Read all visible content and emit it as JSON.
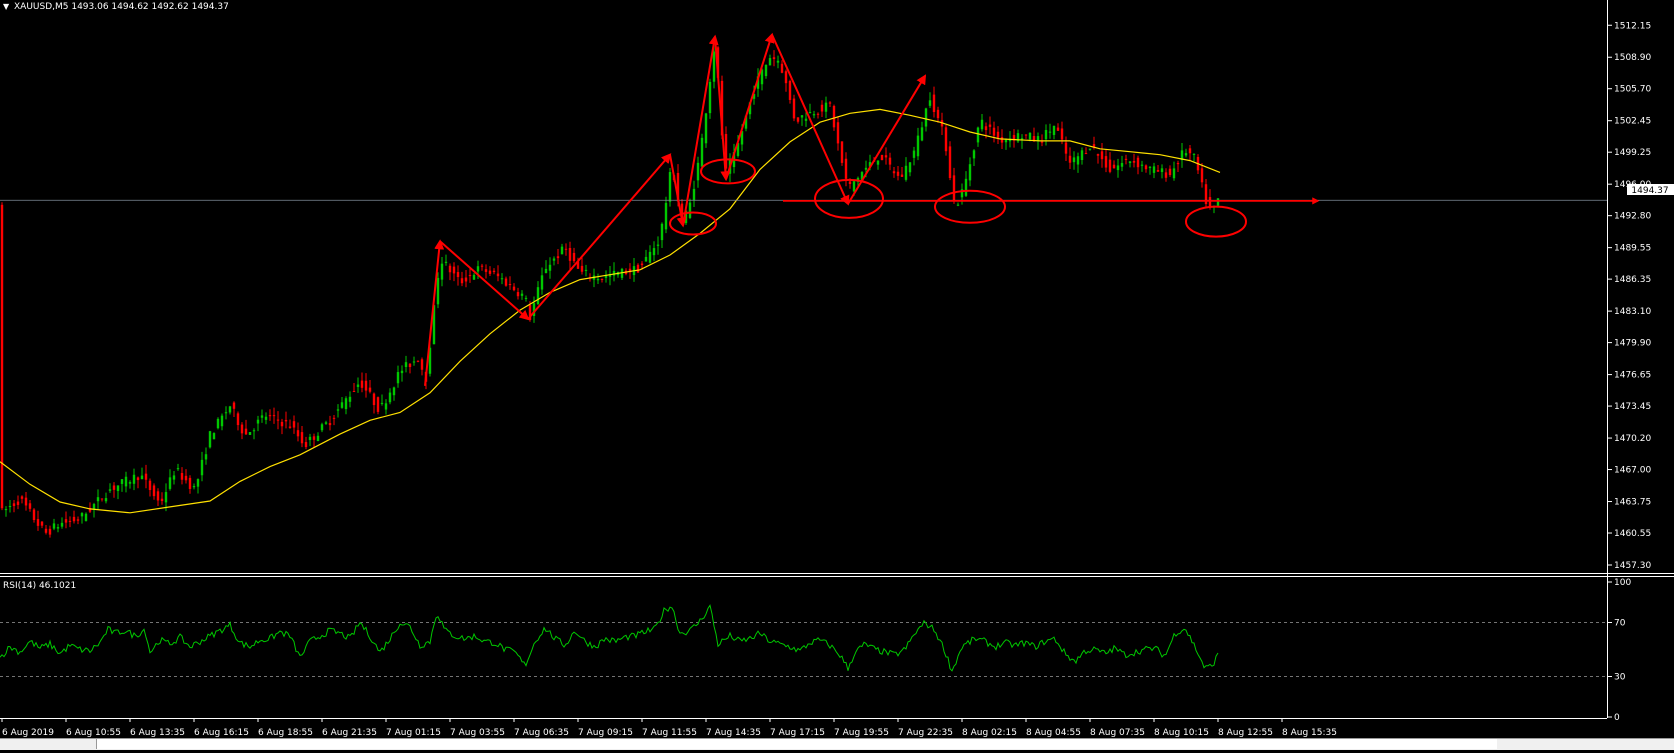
{
  "chart_data": [
    {
      "type": "candlestick",
      "title": "XAUUSD,M5  1493.06 1494.62 1492.62 1494.37",
      "symbol": "XAUUSD,M5",
      "ohlc": {
        "open": 1493.06,
        "high": 1494.62,
        "low": 1492.62,
        "close": 1494.37
      },
      "ylim": [
        1457.3,
        1513.7
      ],
      "y_ticks": [
        "1512.15",
        "1508.90",
        "1505.70",
        "1502.45",
        "1499.25",
        "1496.00",
        "1492.80",
        "1489.55",
        "1486.35",
        "1483.10",
        "1479.90",
        "1476.65",
        "1473.45",
        "1470.20",
        "1467.00",
        "1463.75",
        "1460.55",
        "1457.30"
      ],
      "current_price_label": "1494.37",
      "bull_color": "#00c800",
      "bear_color": "#ff0000",
      "ma_color": "#ffe000",
      "annotation_color": "#ff0000",
      "price_path": [
        [
          0,
          1462.5
        ],
        [
          20,
          1464.0
        ],
        [
          45,
          1460.5
        ],
        [
          60,
          1461.5
        ],
        [
          80,
          1462.0
        ],
        [
          110,
          1465.0
        ],
        [
          140,
          1466.5
        ],
        [
          160,
          1463.5
        ],
        [
          175,
          1467.0
        ],
        [
          195,
          1465.0
        ],
        [
          210,
          1470.5
        ],
        [
          230,
          1473.5
        ],
        [
          245,
          1470.5
        ],
        [
          265,
          1472.5
        ],
        [
          290,
          1471.5
        ],
        [
          305,
          1469.5
        ],
        [
          330,
          1472.0
        ],
        [
          360,
          1476.0
        ],
        [
          380,
          1473.0
        ],
        [
          400,
          1477.0
        ],
        [
          420,
          1478.5
        ],
        [
          425,
          1475.5
        ],
        [
          440,
          1488.5
        ],
        [
          460,
          1486.0
        ],
        [
          480,
          1487.5
        ],
        [
          500,
          1486.5
        ],
        [
          525,
          1484.5
        ],
        [
          530,
          1482.5
        ],
        [
          545,
          1487.5
        ],
        [
          565,
          1489.5
        ],
        [
          580,
          1487.0
        ],
        [
          600,
          1486.5
        ],
        [
          620,
          1487.0
        ],
        [
          640,
          1487.5
        ],
        [
          660,
          1490.5
        ],
        [
          672,
          1498.0
        ],
        [
          682,
          1492.0
        ],
        [
          690,
          1494.0
        ],
        [
          700,
          1499.0
        ],
        [
          715,
          1510.5
        ],
        [
          725,
          1497.0
        ],
        [
          735,
          1499.0
        ],
        [
          755,
          1506.0
        ],
        [
          770,
          1509.0
        ],
        [
          780,
          1508.5
        ],
        [
          795,
          1502.5
        ],
        [
          815,
          1503.5
        ],
        [
          830,
          1504.0
        ],
        [
          840,
          1499.0
        ],
        [
          848,
          1495.5
        ],
        [
          860,
          1497.0
        ],
        [
          880,
          1499.0
        ],
        [
          900,
          1496.5
        ],
        [
          915,
          1499.5
        ],
        [
          930,
          1505.0
        ],
        [
          945,
          1500.5
        ],
        [
          955,
          1493.5
        ],
        [
          965,
          1496.0
        ],
        [
          980,
          1502.5
        ],
        [
          1000,
          1500.5
        ],
        [
          1020,
          1501.0
        ],
        [
          1040,
          1500.5
        ],
        [
          1055,
          1502.0
        ],
        [
          1070,
          1498.0
        ],
        [
          1090,
          1500.0
        ],
        [
          1110,
          1497.5
        ],
        [
          1130,
          1498.5
        ],
        [
          1150,
          1497.5
        ],
        [
          1170,
          1497.0
        ],
        [
          1185,
          1499.5
        ],
        [
          1195,
          1498.5
        ],
        [
          1205,
          1494.5
        ],
        [
          1212,
          1493.0
        ],
        [
          1218,
          1494.4
        ]
      ],
      "moving_average": [
        [
          0,
          1467.8
        ],
        [
          30,
          1465.5
        ],
        [
          60,
          1463.7
        ],
        [
          90,
          1463.0
        ],
        [
          130,
          1462.6
        ],
        [
          170,
          1463.2
        ],
        [
          210,
          1463.8
        ],
        [
          240,
          1465.8
        ],
        [
          270,
          1467.3
        ],
        [
          300,
          1468.5
        ],
        [
          340,
          1470.6
        ],
        [
          370,
          1472.0
        ],
        [
          400,
          1472.8
        ],
        [
          430,
          1474.8
        ],
        [
          460,
          1478.0
        ],
        [
          490,
          1480.8
        ],
        [
          520,
          1483.2
        ],
        [
          550,
          1485.0
        ],
        [
          580,
          1486.3
        ],
        [
          610,
          1486.8
        ],
        [
          640,
          1487.3
        ],
        [
          670,
          1488.8
        ],
        [
          700,
          1491.0
        ],
        [
          730,
          1493.5
        ],
        [
          760,
          1497.5
        ],
        [
          790,
          1500.3
        ],
        [
          820,
          1502.3
        ],
        [
          850,
          1503.2
        ],
        [
          880,
          1503.6
        ],
        [
          910,
          1503.0
        ],
        [
          940,
          1502.3
        ],
        [
          970,
          1501.3
        ],
        [
          1000,
          1500.6
        ],
        [
          1040,
          1500.4
        ],
        [
          1070,
          1500.4
        ],
        [
          1100,
          1499.6
        ],
        [
          1130,
          1499.3
        ],
        [
          1160,
          1499.0
        ],
        [
          1190,
          1498.4
        ],
        [
          1220,
          1497.2
        ]
      ],
      "zigzag": [
        [
          425,
          1475.5
        ],
        [
          440,
          1490.2
        ],
        [
          528,
          1482.3
        ],
        [
          670,
          1499.0
        ],
        [
          683,
          1491.8
        ],
        [
          715,
          1511.0
        ],
        [
          726,
          1496.5
        ],
        [
          772,
          1511.2
        ],
        [
          848,
          1494.0
        ],
        [
          925,
          1507.0
        ]
      ],
      "ellipses": [
        [
          693,
          1492.0
        ],
        [
          728,
          1497.3
        ],
        [
          849,
          1494.5
        ],
        [
          970,
          1493.7
        ],
        [
          1216,
          1492.2
        ]
      ],
      "support_line": {
        "price": 1494.3,
        "x_start": 783,
        "x_end": 1318
      }
    },
    {
      "type": "line",
      "title": "RSI(14) 46.1021",
      "ylim": [
        0,
        100
      ],
      "y_ticks": [
        "100",
        "70",
        "30",
        "0"
      ],
      "levels": [
        70,
        30
      ],
      "line_color": "#00c800",
      "path": [
        [
          0,
          44
        ],
        [
          10,
          52
        ],
        [
          20,
          48
        ],
        [
          30,
          56
        ],
        [
          40,
          51
        ],
        [
          50,
          54
        ],
        [
          60,
          47
        ],
        [
          70,
          53
        ],
        [
          80,
          50
        ],
        [
          90,
          49
        ],
        [
          100,
          55
        ],
        [
          108,
          65
        ],
        [
          115,
          62
        ],
        [
          125,
          64
        ],
        [
          135,
          60
        ],
        [
          145,
          65
        ],
        [
          150,
          48
        ],
        [
          160,
          57
        ],
        [
          170,
          54
        ],
        [
          180,
          59
        ],
        [
          190,
          52
        ],
        [
          200,
          56
        ],
        [
          210,
          60
        ],
        [
          220,
          64
        ],
        [
          230,
          68
        ],
        [
          240,
          55
        ],
        [
          250,
          52
        ],
        [
          260,
          57
        ],
        [
          270,
          58
        ],
        [
          280,
          63
        ],
        [
          290,
          60
        ],
        [
          300,
          44
        ],
        [
          310,
          56
        ],
        [
          320,
          60
        ],
        [
          330,
          64
        ],
        [
          340,
          62
        ],
        [
          350,
          58
        ],
        [
          360,
          70
        ],
        [
          370,
          60
        ],
        [
          380,
          48
        ],
        [
          390,
          58
        ],
        [
          400,
          70
        ],
        [
          410,
          67
        ],
        [
          420,
          53
        ],
        [
          430,
          56
        ],
        [
          437,
          78
        ],
        [
          445,
          64
        ],
        [
          455,
          60
        ],
        [
          465,
          58
        ],
        [
          475,
          60
        ],
        [
          485,
          56
        ],
        [
          495,
          55
        ],
        [
          505,
          50
        ],
        [
          515,
          48
        ],
        [
          525,
          38
        ],
        [
          535,
          56
        ],
        [
          545,
          66
        ],
        [
          555,
          58
        ],
        [
          565,
          53
        ],
        [
          575,
          64
        ],
        [
          585,
          56
        ],
        [
          595,
          52
        ],
        [
          605,
          58
        ],
        [
          615,
          56
        ],
        [
          625,
          59
        ],
        [
          635,
          60
        ],
        [
          645,
          63
        ],
        [
          655,
          65
        ],
        [
          665,
          80
        ],
        [
          672,
          82
        ],
        [
          680,
          62
        ],
        [
          690,
          64
        ],
        [
          700,
          71
        ],
        [
          710,
          82
        ],
        [
          718,
          54
        ],
        [
          730,
          60
        ],
        [
          740,
          56
        ],
        [
          750,
          58
        ],
        [
          760,
          62
        ],
        [
          770,
          56
        ],
        [
          780,
          54
        ],
        [
          790,
          52
        ],
        [
          800,
          49
        ],
        [
          810,
          55
        ],
        [
          820,
          57
        ],
        [
          830,
          53
        ],
        [
          840,
          46
        ],
        [
          848,
          36
        ],
        [
          855,
          48
        ],
        [
          865,
          54
        ],
        [
          875,
          50
        ],
        [
          885,
          48
        ],
        [
          895,
          46
        ],
        [
          905,
          50
        ],
        [
          915,
          62
        ],
        [
          925,
          70
        ],
        [
          935,
          64
        ],
        [
          945,
          49
        ],
        [
          952,
          34
        ],
        [
          962,
          52
        ],
        [
          975,
          58
        ],
        [
          985,
          56
        ],
        [
          995,
          52
        ],
        [
          1005,
          55
        ],
        [
          1015,
          53
        ],
        [
          1025,
          55
        ],
        [
          1035,
          52
        ],
        [
          1045,
          56
        ],
        [
          1055,
          58
        ],
        [
          1065,
          47
        ],
        [
          1075,
          41
        ],
        [
          1085,
          49
        ],
        [
          1095,
          50
        ],
        [
          1105,
          47
        ],
        [
          1115,
          51
        ],
        [
          1125,
          46
        ],
        [
          1135,
          48
        ],
        [
          1145,
          50
        ],
        [
          1155,
          51
        ],
        [
          1165,
          45
        ],
        [
          1175,
          62
        ],
        [
          1185,
          66
        ],
        [
          1195,
          52
        ],
        [
          1205,
          36
        ],
        [
          1212,
          38
        ],
        [
          1218,
          46
        ]
      ]
    }
  ],
  "time_axis": {
    "labels": [
      "6 Aug 2019",
      "6 Aug 10:55",
      "6 Aug 13:35",
      "6 Aug 16:15",
      "6 Aug 18:55",
      "6 Aug 21:35",
      "7 Aug 01:15",
      "7 Aug 03:55",
      "7 Aug 06:35",
      "7 Aug 09:15",
      "7 Aug 11:55",
      "7 Aug 14:35",
      "7 Aug 17:15",
      "7 Aug 19:55",
      "7 Aug 22:35",
      "8 Aug 02:15",
      "8 Aug 04:55",
      "8 Aug 07:35",
      "8 Aug 10:15",
      "8 Aug 12:55",
      "8 Aug 15:35"
    ]
  }
}
